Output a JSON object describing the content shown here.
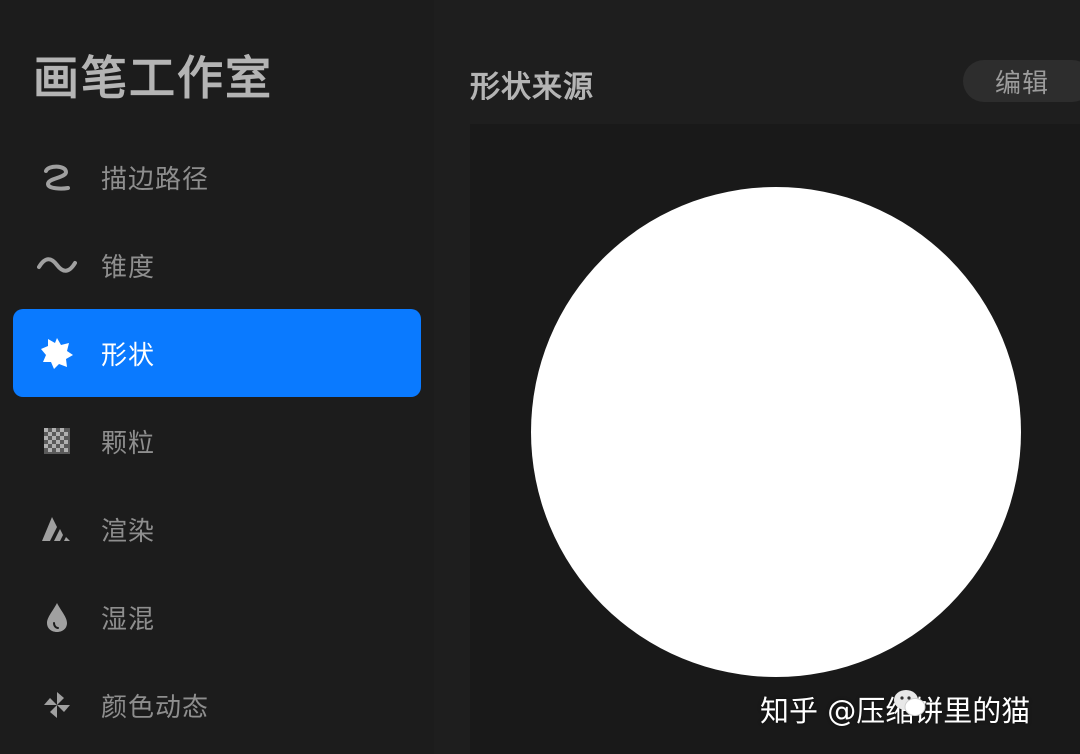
{
  "sidebar": {
    "title": "画笔工作室",
    "items": [
      {
        "label": "描边路径",
        "icon": "stroke-path-icon"
      },
      {
        "label": "锥度",
        "icon": "taper-icon"
      },
      {
        "label": "形状",
        "icon": "shape-icon",
        "active": true
      },
      {
        "label": "颗粒",
        "icon": "grain-icon"
      },
      {
        "label": "渲染",
        "icon": "rendering-icon"
      },
      {
        "label": "湿混",
        "icon": "wet-mix-icon"
      },
      {
        "label": "颜色动态",
        "icon": "color-dynamics-icon"
      }
    ]
  },
  "main": {
    "section_title": "形状来源",
    "edit_label": "编辑",
    "shape_preview": "circle"
  },
  "watermark": {
    "text_left": "知乎 @压",
    "text_right": "缩饼里的猫"
  },
  "colors": {
    "accent": "#0a7aff",
    "background": "#1c1c1c",
    "canvas": "#191919",
    "shape": "#ffffff"
  }
}
